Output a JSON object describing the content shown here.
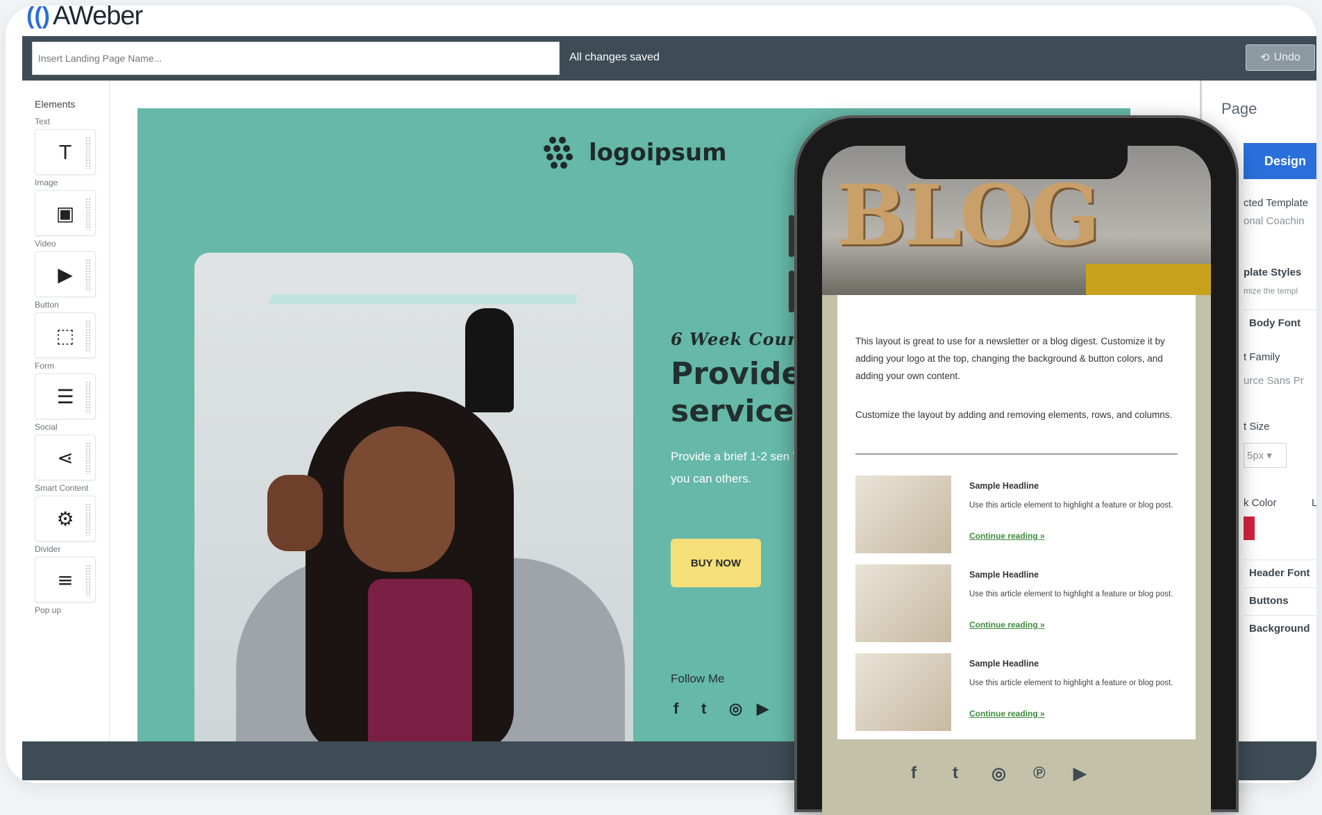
{
  "brand": {
    "mark": "(()",
    "name": "AWeber"
  },
  "topbar": {
    "name_placeholder": "Insert Landing Page Name...",
    "status": "All changes saved",
    "undo_label": "Undo"
  },
  "sidebar": {
    "title": "Elements",
    "items": [
      {
        "label": "Text",
        "icon": "T"
      },
      {
        "label": "Image",
        "icon": "▣"
      },
      {
        "label": "Video",
        "icon": "▶"
      },
      {
        "label": "Button",
        "icon": "⬚"
      },
      {
        "label": "Form",
        "icon": "☰"
      },
      {
        "label": "Social",
        "icon": "⋖"
      },
      {
        "label": "Smart Content",
        "icon": "⚙"
      },
      {
        "label": "Divider",
        "icon": "≡"
      },
      {
        "label": "Pop up",
        "icon": ""
      }
    ]
  },
  "landing": {
    "logo_text": "logoipsum",
    "logo_sup": "°",
    "course_label": "6 Week Course",
    "headline": "Provide t services",
    "description": "Provide a brief 1-2 sen Tell them how you can others.",
    "buy_label": "BUY NOW",
    "follow_label": "Follow Me",
    "social": [
      "f",
      "t",
      "◎",
      "▶"
    ]
  },
  "right_panel": {
    "title": "Page",
    "design_tab": "Design",
    "selected_template": "cted Template",
    "template_name": "onal Coachin",
    "template_styles": "plate Styles",
    "template_sub": "mize the templ",
    "rows": [
      "Body Font",
      "Header Font",
      "Buttons",
      "Background"
    ],
    "font_family_label": "t Family",
    "font_family_value": "urce Sans Pr",
    "font_size_label": "t Size",
    "font_size_value": "5px",
    "color_label": "k Color",
    "li_label": "Li"
  },
  "phone": {
    "hero_word": "BLOG",
    "intro1": "This layout is great to use for a newsletter or a blog digest. Customize it by adding your logo at the top, changing the background & button colors, and adding your own content.",
    "intro2": "Customize the layout by adding and removing elements, rows, and columns.",
    "posts": [
      {
        "headline": "Sample Headline",
        "text": "Use this article element to highlight a feature or blog post.",
        "link": "Continue reading »"
      },
      {
        "headline": "Sample Headline",
        "text": "Use this article element to highlight a feature or blog post.",
        "link": "Continue reading »"
      },
      {
        "headline": "Sample Headline",
        "text": "Use this article element to highlight a feature or blog post.",
        "link": "Continue reading »"
      }
    ],
    "social": [
      "f",
      "t",
      "◎",
      "℗",
      "▶"
    ]
  },
  "colors": {
    "topbar": "#3d4c55",
    "accent": "#2a6fdb",
    "landing_bg": "#66b8a8",
    "buy_button": "#f4df79",
    "phone_bg": "#c4c1a9"
  }
}
